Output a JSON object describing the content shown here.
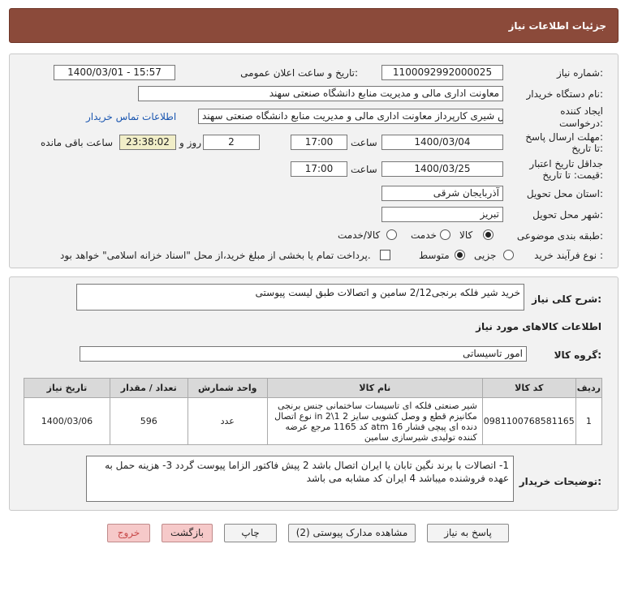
{
  "header": {
    "title": "جزئیات اطلاعات نیاز"
  },
  "form": {
    "need_number_label": "شماره نیاز:",
    "need_number": "1100092992000025",
    "announce_label": "تاریخ و ساعت اعلان عمومی:",
    "announce_value": "1400/03/01 - 15:57",
    "buyer_org_label": "نام دستگاه خریدار:",
    "buyer_org": "معاونت اداری  مالی و مدیریت منابع دانشگاه صنعتی سهند",
    "creator_label_1": "ایجاد کننده",
    "creator_label_2": "درخواست:",
    "creator": "عباس شیری کارپرداز معاونت اداری  مالی و مدیریت منابع دانشگاه صنعتی سهند",
    "contact_link": "اطلاعات تماس خریدار",
    "deadline_label_1": "مهلت ارسال پاسخ:",
    "deadline_label_2": "تا تاریخ:",
    "deadline_date": "1400/03/04",
    "time_label": "ساعت",
    "deadline_time": "17:00",
    "days_value": "2",
    "days_label": "روز و",
    "remaining_time": "23:38:02",
    "remaining_label": "ساعت باقی مانده",
    "validity_label_1": "جداقل تاریخ اعتبار",
    "validity_label_2": "قیمت: تا تاریخ:",
    "validity_date": "1400/03/25",
    "validity_time_label": "ساعت",
    "validity_time": "17:00",
    "province_label": "استان محل تحویل:",
    "province": "آذربایجان شرقی",
    "city_label": "شهر محل تحویل:",
    "city": "تبریز",
    "category_label": "طبقه بندی موضوعی:",
    "category_options": [
      "کالا",
      "خدمت",
      "کالا/خدمت"
    ],
    "category_selected": "کالا",
    "process_label": "نوع فرآیند خرید :",
    "process_options": [
      "جزیی",
      "متوسط"
    ],
    "process_selected": "متوسط",
    "treasury_note": "پرداخت تمام یا بخشی از مبلغ خرید،از محل \"اسناد خزانه اسلامی\" خواهد بود."
  },
  "summary": {
    "label": "شرح کلی نیاز:",
    "text": "خرید شیر فلکه برنجی2/12 سامین و اتصالات طبق لیست پیوستی"
  },
  "goods": {
    "section_title": "اطلاعات کالاهای مورد نیاز",
    "group_label": "گروه کالا:",
    "group_value": "امور تاسیساتی",
    "columns": [
      "ردیف",
      "کد کالا",
      "نام کالا",
      "واحد شمارش",
      "تعداد / مقدار",
      "تاریخ نیاز"
    ],
    "rows": [
      {
        "row": "1",
        "code": "0981100768581165",
        "name": "شیر صنعتی فلکه ای تاسیسات ساختمانی جنس برنجی مکانیزم قطع و وصل کشویی سایز 2 1\\2 in نوع اتصال دنده ای پیچی فشار 16 atm کد 1165 مرجع عرضه کننده تولیدی شیرسازی سامین",
        "unit": "عدد",
        "qty": "596",
        "date": "1400/03/06"
      }
    ]
  },
  "buyer_notes": {
    "label": "توضیحات خریدار:",
    "text": "1- اتصالات با برند نگین تابان یا ایران اتصال باشد 2 پیش فاکتور الزاما پیوست گردد 3- هزینه حمل به عهده فروشنده میباشد 4 ایران کد مشابه می باشد"
  },
  "buttons": {
    "reply": "پاسخ به نیاز",
    "view_docs": "مشاهده مدارک پیوستی (2)",
    "print": "چاپ",
    "back": "بازگشت",
    "exit": "خروج"
  },
  "colors": {
    "header_bg": "#8b4a3a",
    "panel_bg": "#f2f2f2",
    "link": "#1a56b0",
    "remaining_bg": "#f1eec8",
    "exit_btn": "#f6c9c9"
  }
}
